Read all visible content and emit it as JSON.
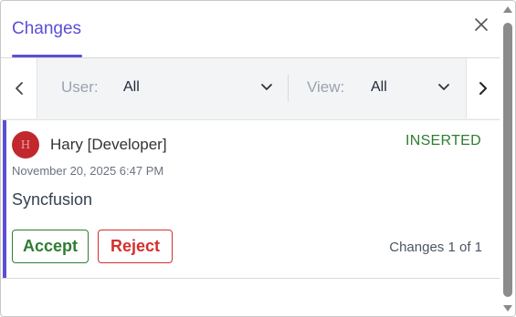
{
  "header": {
    "tab_label": "Changes"
  },
  "filters": {
    "user_label": "User:",
    "user_value": "All",
    "view_label": "View:",
    "view_value": "All"
  },
  "change": {
    "avatar_initial": "H",
    "avatar_color": "#c1272d",
    "author": "Hary [Developer]",
    "type": "INSERTED",
    "timestamp": "November 20, 2025 6:47 PM",
    "text": "Syncfusion",
    "accept_label": "Accept",
    "reject_label": "Reject",
    "counter": "Changes 1 of 1"
  },
  "icons": {
    "close": "close-icon",
    "prev": "chevron-left-icon",
    "next": "chevron-right-icon",
    "dropdown": "chevron-down-icon"
  },
  "colors": {
    "accent": "#5b4fd6",
    "accept": "#2e7d32",
    "reject": "#d32f2f"
  }
}
